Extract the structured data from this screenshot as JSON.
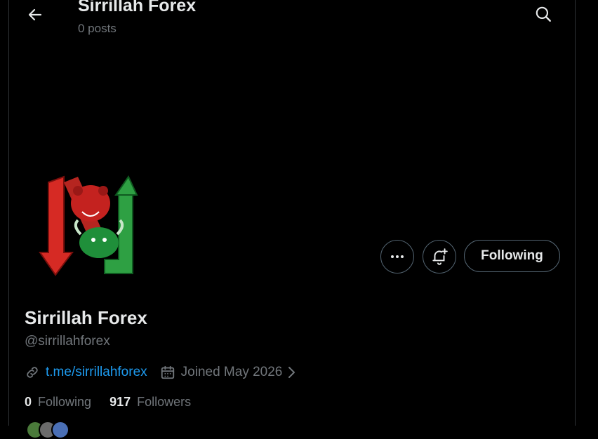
{
  "header": {
    "title": "Sirrillah Forex",
    "posts_count": "0 posts"
  },
  "profile": {
    "display_name": "Sirrillah Forex",
    "handle": "@sirrillahforex",
    "link_text": "t.me/sirrillahforex",
    "joined": "Joined May 2026"
  },
  "actions": {
    "following_label": "Following"
  },
  "stats": {
    "following_count": "0",
    "following_label": "Following",
    "followers_count": "917",
    "followers_label": "Followers"
  },
  "icons": {
    "back": "arrow-left-icon",
    "search": "search-icon",
    "more": "more-dots-icon",
    "notify": "bell-plus-icon",
    "link": "link-icon",
    "calendar": "calendar-icon",
    "chevron": "chevron-right-icon"
  },
  "colors": {
    "background": "#000000",
    "text_primary": "#e7e9ea",
    "text_secondary": "#71767b",
    "link": "#1d9bf0",
    "border": "#536471"
  }
}
